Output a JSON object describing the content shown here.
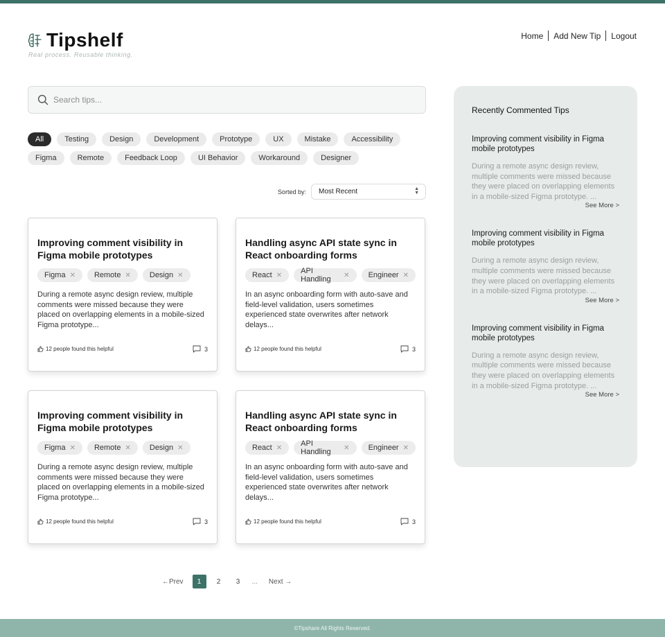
{
  "brand": {
    "name": "Tipshelf",
    "tagline": "Real process. Reusable thinking."
  },
  "nav": [
    "Home",
    "Add New Tip",
    "Logout"
  ],
  "search": {
    "placeholder": "Search tips..."
  },
  "filters": {
    "active": "All",
    "row1": [
      "All",
      "Testing",
      "Design",
      "Development",
      "Prototype",
      "UX",
      "Mistake",
      "Accessibility"
    ],
    "row2": [
      "Figma",
      "Remote",
      "Feedback Loop",
      "UI Behavior",
      "Workaround",
      "Designer"
    ]
  },
  "sort": {
    "label": "Sorted by:",
    "value": "Most Recent"
  },
  "cards": [
    {
      "title": "Improving comment visibility in Figma mobile prototypes",
      "tags": [
        "Figma",
        "Remote",
        "Design"
      ],
      "body": "During a remote async design review, multiple comments were missed because they were placed on overlapping elements in a mobile-sized Figma prototype...",
      "helpful": "12 people found this helpful",
      "comments": "3"
    },
    {
      "title": "Handling async API state sync in React onboarding forms",
      "tags": [
        "React",
        "API Handling",
        "Engineer"
      ],
      "body": "In an async onboarding form with auto-save and field-level validation, users sometimes experienced state overwrites after network delays...",
      "helpful": "12 people found this helpful",
      "comments": "3"
    },
    {
      "title": "Improving comment visibility in Figma mobile prototypes",
      "tags": [
        "Figma",
        "Remote",
        "Design"
      ],
      "body": "During a remote async design review, multiple comments were missed because they were placed on overlapping elements in a mobile-sized Figma prototype...",
      "helpful": "12 people found this helpful",
      "comments": "3"
    },
    {
      "title": "Handling async API state sync in React onboarding forms",
      "tags": [
        "React",
        "API Handling",
        "Engineer"
      ],
      "body": "In an async onboarding form with auto-save and field-level validation, users sometimes experienced state overwrites after network delays...",
      "helpful": "12 people found this helpful",
      "comments": "3"
    }
  ],
  "pagination": {
    "prev": "←Prev",
    "pages": [
      "1",
      "2",
      "3"
    ],
    "current": "1",
    "ellipsis": "...",
    "next": "Next →"
  },
  "sidebar": {
    "title": "Recently Commented Tips",
    "items": [
      {
        "title": "Improving comment visibility in Figma mobile prototypes",
        "body": "During a remote async design review, multiple comments were missed because they were placed on overlapping elements in a mobile-sized Figma prototype. ...",
        "more": "See More >"
      },
      {
        "title": "Improving comment visibility in Figma mobile prototypes",
        "body": "During a remote async design review, multiple comments were missed because they were placed on overlapping elements in a mobile-sized Figma prototype. ...",
        "more": "See More >"
      },
      {
        "title": "Improving comment visibility in Figma mobile prototypes",
        "body": "During a remote async design review, multiple comments were missed because they were placed on overlapping elements in a mobile-sized Figma prototype. ...",
        "more": "See More >"
      }
    ]
  },
  "footer": "©Tipshare All Rights Reserved.",
  "colors": {
    "accent": "#3d7268",
    "footer_bg": "#8fb5aa",
    "sidebar_bg": "#e7ecea"
  },
  "icons": {
    "logo": "brain-icon",
    "search": "search-icon",
    "helpful": "thumbs-up-icon",
    "comments": "comment-icon",
    "tag_remove": "close-icon",
    "sort": "updown-caret-icon"
  }
}
